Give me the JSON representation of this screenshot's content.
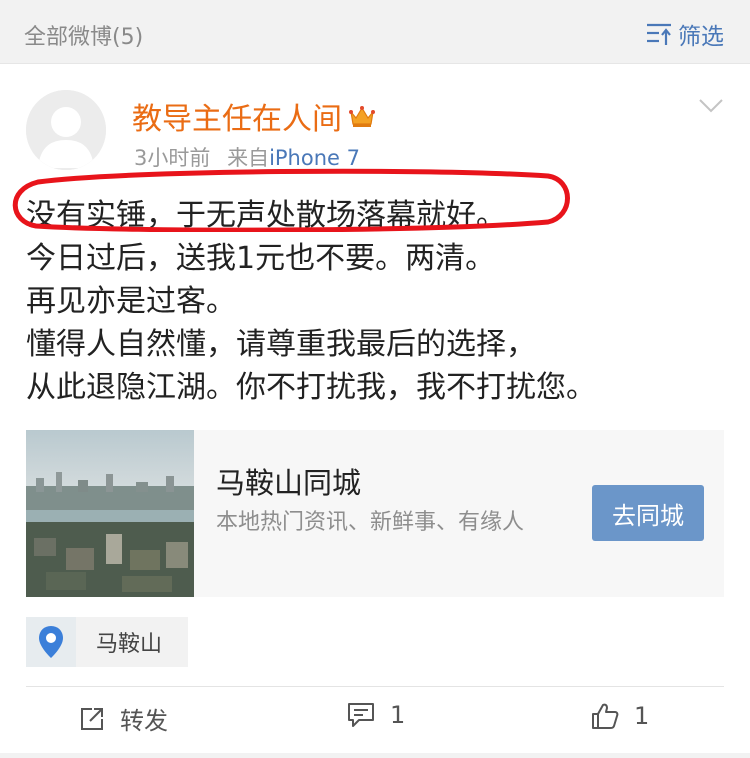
{
  "header": {
    "title": "全部微博(5)",
    "filter_label": "筛选",
    "filter_icon": "filter-icon"
  },
  "post": {
    "username": "教导主任在人间",
    "badge_icon": "crown-icon",
    "time": "3小时前",
    "source_prefix": "来自",
    "source": "iPhone 7",
    "lines": [
      "没有实锤，于无声处散场落幕就好。",
      "今日过后，送我1元也不要。两清。",
      "再见亦是过客。",
      "懂得人自然懂，请尊重我最后的选择，",
      "从此退隐江湖。你不打扰我，我不打扰您。"
    ],
    "highlight_color": "#e8141b",
    "link_card": {
      "title": "马鞍山同城",
      "description": "本地热门资讯、新鲜事、有缘人",
      "button": "去同城"
    },
    "location": "马鞍山"
  },
  "actions": {
    "repost_label": "转发",
    "comment_count": "1",
    "like_count": "1"
  },
  "colors": {
    "username": "#ea6c14",
    "link": "#4a78b8",
    "button": "#6b96c9"
  }
}
